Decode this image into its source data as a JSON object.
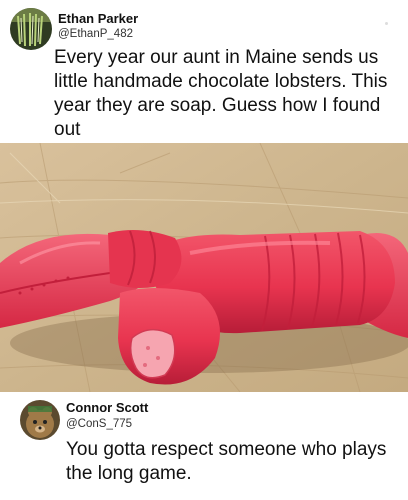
{
  "post1": {
    "author_name": "Ethan Parker",
    "author_handle": "@EthanP_482",
    "text": "Every year our aunt in Maine sends us little handmade chocolate lobsters. This year they are soap. Guess how I found out"
  },
  "photo": {
    "subject": "red lobster-shaped soap with a bite taken out, on a wooden cutting board"
  },
  "reply": {
    "author_name": "Connor Scott",
    "author_handle": "@ConS_775",
    "text": "You gotta respect someone who plays the long game."
  },
  "colors": {
    "background": "#ffffff",
    "text": "#111111",
    "soap_red": "#e8344f"
  }
}
